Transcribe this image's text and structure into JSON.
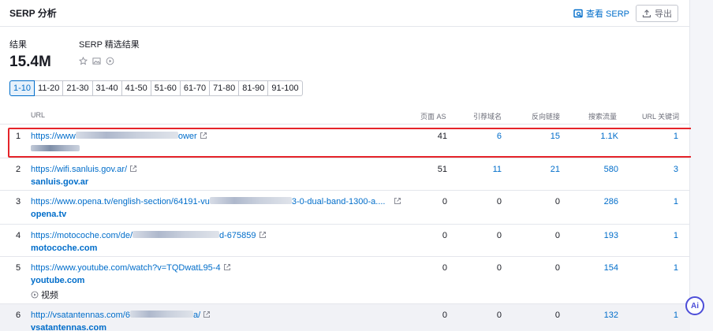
{
  "header": {
    "title": "SERP 分析",
    "view_serp": "查看 SERP",
    "export": "导出"
  },
  "summary": {
    "results_label": "结果",
    "results_value": "15.4M",
    "features_label": "SERP 精选结果"
  },
  "pagination": [
    "1-10",
    "11-20",
    "21-30",
    "31-40",
    "41-50",
    "51-60",
    "61-70",
    "71-80",
    "81-90",
    "91-100"
  ],
  "pagination_active": "1-10",
  "columns": {
    "url": "URL",
    "page_as": "页面 AS",
    "ref_domains": "引荐域名",
    "backlinks": "反向链接",
    "traffic": "搜索流量",
    "url_keywords": "URL 关键词"
  },
  "rows": [
    {
      "num": "1",
      "url_a": "https://www",
      "url_b": "ower",
      "domain": "",
      "page_as": "41",
      "ref_domains": "6",
      "backlinks": "15",
      "traffic": "1.1K",
      "keywords": "1"
    },
    {
      "num": "2",
      "url_a": "https://wifi.sanluis.gov.ar/",
      "url_b": "",
      "domain": "sanluis.gov.ar",
      "page_as": "51",
      "ref_domains": "11",
      "backlinks": "21",
      "traffic": "580",
      "keywords": "3"
    },
    {
      "num": "3",
      "url_a": "https://www.opena.tv/english-section/64191-vu",
      "url_b": "3-0-dual-band-1300-a....",
      "domain": "opena.tv",
      "page_as": "0",
      "ref_domains": "0",
      "backlinks": "0",
      "traffic": "286",
      "keywords": "1"
    },
    {
      "num": "4",
      "url_a": "https://motocoche.com/de/",
      "url_b": "d-675859",
      "domain": "motocoche.com",
      "page_as": "0",
      "ref_domains": "0",
      "backlinks": "0",
      "traffic": "193",
      "keywords": "1"
    },
    {
      "num": "5",
      "url_a": "https://www.youtube.com/watch?v=TQDwatL95-4",
      "url_b": "",
      "domain": "youtube.com",
      "feature": "视频",
      "page_as": "0",
      "ref_domains": "0",
      "backlinks": "0",
      "traffic": "154",
      "keywords": "1"
    },
    {
      "num": "6",
      "url_a": "http://vsatantennas.com/6",
      "url_b": "a/",
      "domain": "vsatantennas.com",
      "page_as": "0",
      "ref_domains": "0",
      "backlinks": "0",
      "traffic": "132",
      "keywords": "1"
    }
  ],
  "ai_button": "Ai",
  "colors": {
    "accent": "#006dca",
    "highlight": "#e5242a",
    "ai": "#4d4ed8"
  },
  "icons": {
    "view_serp": "serp-view-icon",
    "export": "upload-icon",
    "external": "external-link-icon",
    "star": "star-icon",
    "image": "image-icon",
    "video": "video-play-icon"
  }
}
